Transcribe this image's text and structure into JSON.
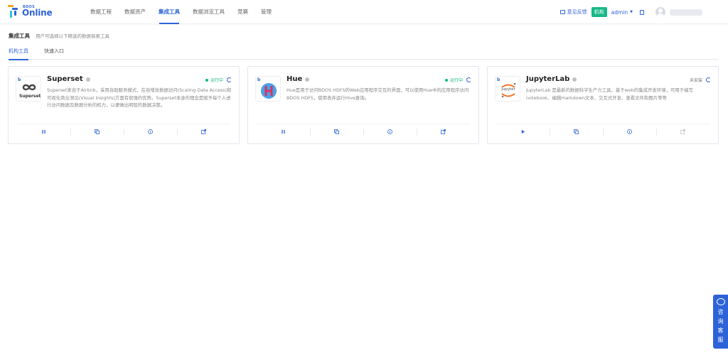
{
  "header": {
    "logo_small": "BDOS",
    "logo_big": "Online",
    "nav": [
      {
        "label": "数据工程",
        "active": false
      },
      {
        "label": "数据资产",
        "active": false
      },
      {
        "label": "集成工具",
        "active": true
      },
      {
        "label": "数据浏览工具",
        "active": false
      },
      {
        "label": "竞赛",
        "active": false
      },
      {
        "label": "管理",
        "active": false
      }
    ],
    "feedback_label": "意见反馈",
    "org_tag": "机构",
    "user": "admin",
    "colors": {
      "primary": "#2e63d8",
      "success": "#18b887"
    }
  },
  "page": {
    "title": "集成工具",
    "description": "用户可选择以下精选的数据探索工具",
    "tabs": [
      {
        "label": "机构工具",
        "active": true
      },
      {
        "label": "快速入口",
        "active": false
      }
    ]
  },
  "cards": [
    {
      "name": "Superset",
      "logo_text": "Superset",
      "status": "运行中",
      "running": true,
      "description": "Superset来自于Airbnb，采用自助服务模式，在自增效数据访问(Scaling Data Access)和可视化商业洞见(Visual Insights)方面有很强的优势。Superset本身的理念是赋予每个人进行访问数据及数据分析的权力，以便做出明智的数据决策。",
      "actions": [
        "pause-icon",
        "copy-icon",
        "info-icon",
        "open-external-icon"
      ]
    },
    {
      "name": "Hue",
      "logo_text": "H",
      "status": "运行中",
      "running": true,
      "description": "Hue是用于访问BDOS HDFS的Web应用程序交互的界面，可以使用Hue中的应用程序访问BDOS HDFS，使用表并运行Hive查询。",
      "actions": [
        "pause-icon",
        "copy-icon",
        "info-icon",
        "open-external-icon"
      ]
    },
    {
      "name": "JupyterLab",
      "logo_text": "jupyter",
      "status": "未安装",
      "running": false,
      "description": "JupyterLab 是最新的数据科学生产力工具，基于web的集成开发环境，可用于编写notebook、编辑markdown文本、交互式开发、查看文件和图片等等",
      "actions": [
        "play-icon",
        "copy-icon",
        "info-icon",
        "open-external-icon"
      ]
    }
  ],
  "chat_widget": {
    "label": "咨询客服"
  }
}
